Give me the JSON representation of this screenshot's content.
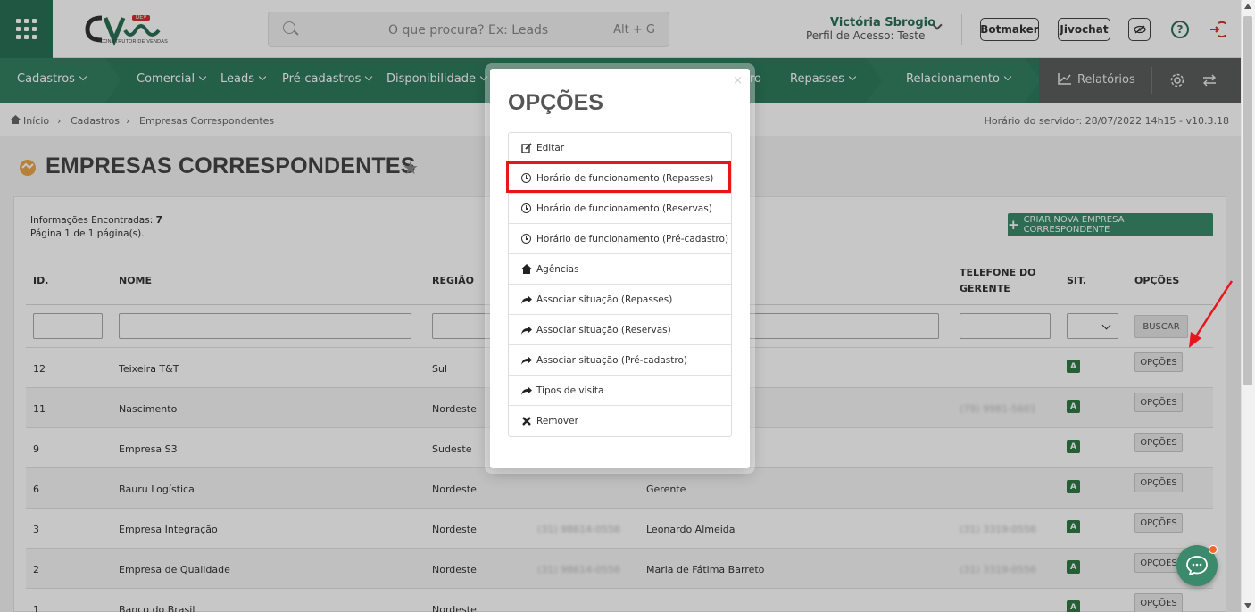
{
  "header": {
    "search_placeholder": "O que procura? Ex: Leads",
    "search_shortcut": "Alt + G",
    "user_name": "Victória Sbrogio",
    "user_profile": "Perfil de Acesso: Teste",
    "botmaker": "Botmaker",
    "jivochat": "Jivochat",
    "logo_badge": "DEV",
    "logo_sub": "CONSTRUTOR DE VENDAS"
  },
  "nav": {
    "items": [
      "Cadastros",
      "Comercial",
      "Leads",
      "Pré-cadastros",
      "Disponibilidade",
      "ro",
      "Repasses",
      "Relacionamento"
    ],
    "reports": "Relatórios"
  },
  "breadcrumb": {
    "home": "Início",
    "level1": "Cadastros",
    "level2": "Empresas Correspondentes",
    "server_time": "Horário do servidor: 28/07/2022 14h15 - v10.3.18"
  },
  "page": {
    "title": "EMPRESAS CORRESPONDENTES",
    "info_found_label": "Informações Encontradas:",
    "info_found_value": "7",
    "pagination": "Página 1 de 1 página(s).",
    "create_button": "CRIAR NOVA EMPRESA CORRESPONDENTE"
  },
  "table": {
    "headers": {
      "id": "ID.",
      "name": "NOME",
      "region": "REGIÃO",
      "manager_phone": "TELEFONE DO GERENTE",
      "status": "SIT.",
      "options": "OPÇÕES"
    },
    "search_button": "BUSCAR",
    "rows": [
      {
        "id": "12",
        "name": "Teixeira T&T",
        "region": "Sul",
        "phone": "",
        "manager": "",
        "manager_phone": "",
        "status": "A",
        "options": "OPÇÕES"
      },
      {
        "id": "11",
        "name": "Nascimento",
        "region": "Nordeste",
        "phone": "",
        "manager": "",
        "manager_phone": "(79) 9981-5601",
        "status": "A",
        "options": "OPÇÕES"
      },
      {
        "id": "9",
        "name": "Empresa S3",
        "region": "Sudeste",
        "phone": "",
        "manager": "",
        "manager_phone": "",
        "status": "A",
        "options": "OPÇÕES"
      },
      {
        "id": "6",
        "name": "Bauru Logística",
        "region": "Nordeste",
        "phone": "",
        "manager": "Gerente",
        "manager_phone": "",
        "status": "A",
        "options": "OPÇÕES"
      },
      {
        "id": "3",
        "name": "Empresa Integração",
        "region": "Nordeste",
        "phone": "(31) 98614-0556",
        "manager": "Leonardo Almeida",
        "manager_phone": "(31) 3319-0556",
        "status": "A",
        "options": "OPÇÕES"
      },
      {
        "id": "2",
        "name": "Empresa de Qualidade",
        "region": "Nordeste",
        "phone": "(31) 98614-0556",
        "manager": "Maria de Fátima Barreto",
        "manager_phone": "(31) 3319-0556",
        "status": "A",
        "options": "OPÇÕES"
      },
      {
        "id": "1",
        "name": "Banco do Brasil",
        "region": "Nordeste",
        "phone": "",
        "manager": "",
        "manager_phone": "",
        "status": "A",
        "options": "OPÇÕES"
      }
    ]
  },
  "modal": {
    "title": "OPÇÕES",
    "close": "×",
    "items": [
      {
        "icon": "edit-icon",
        "label": "Editar"
      },
      {
        "icon": "clock-icon",
        "label": "Horário de funcionamento (Repasses)"
      },
      {
        "icon": "clock-icon",
        "label": "Horário de funcionamento (Reservas)"
      },
      {
        "icon": "clock-icon",
        "label": "Horário de funcionamento (Pré-cadastro)"
      },
      {
        "icon": "home-icon",
        "label": "Agências"
      },
      {
        "icon": "share-icon",
        "label": "Associar situação (Repasses)"
      },
      {
        "icon": "share-icon",
        "label": "Associar situação (Reservas)"
      },
      {
        "icon": "share-icon",
        "label": "Associar situação (Pré-cadastro)"
      },
      {
        "icon": "share-icon",
        "label": "Tipos de visita"
      },
      {
        "icon": "close-icon",
        "label": "Remover"
      }
    ]
  },
  "colors": {
    "brand_green": "#2f7a5b",
    "highlight_red": "#e8161b"
  }
}
